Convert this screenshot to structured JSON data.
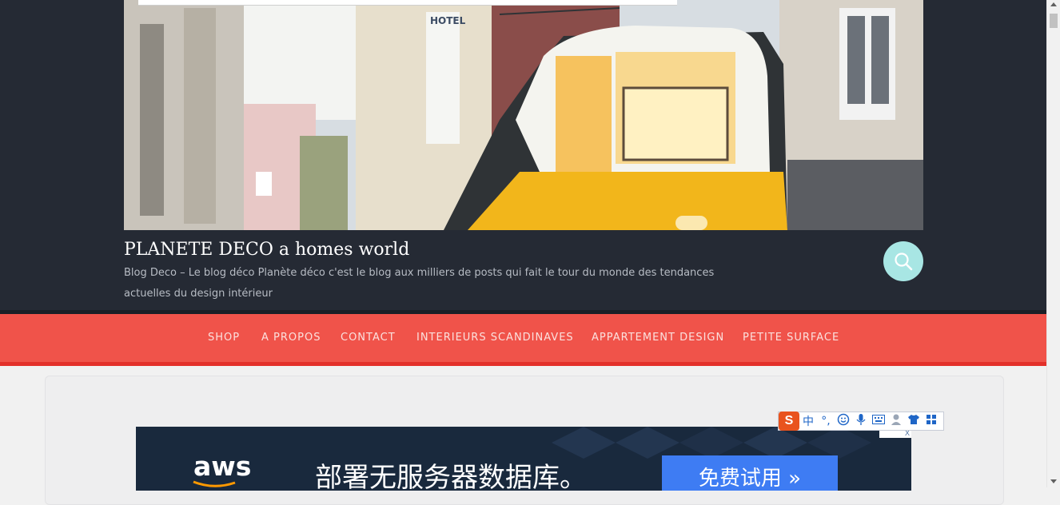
{
  "header": {
    "site_title": "PLANETE DECO a homes world",
    "site_description": "Blog Deco – Le blog déco Planète déco c'est le blog aux milliers de posts qui fait le tour du monde des tendances actuelles du design intérieur",
    "search_icon": "search-icon",
    "hero_sign": "HOTEL"
  },
  "nav": {
    "items": [
      {
        "label": "SHOP"
      },
      {
        "label": "A PROPOS"
      },
      {
        "label": "CONTACT"
      },
      {
        "label": "INTERIEURS SCANDINAVES"
      },
      {
        "label": "APPARTEMENT DESIGN"
      },
      {
        "label": "PETITE SURFACE"
      }
    ]
  },
  "ad": {
    "brand": "aws",
    "headline": "部署无服务器数据库。",
    "cta": "免费试用 »",
    "close_label": "X"
  },
  "ime_toolbar": {
    "logo": "S",
    "mode": "中",
    "punct": "°,"
  },
  "colors": {
    "header_bg": "#252a34",
    "nav_bg": "#f0534a",
    "search_bg": "#a8e6e4",
    "ad_bg": "#19293d",
    "cta_bg": "#3e7cf3"
  }
}
